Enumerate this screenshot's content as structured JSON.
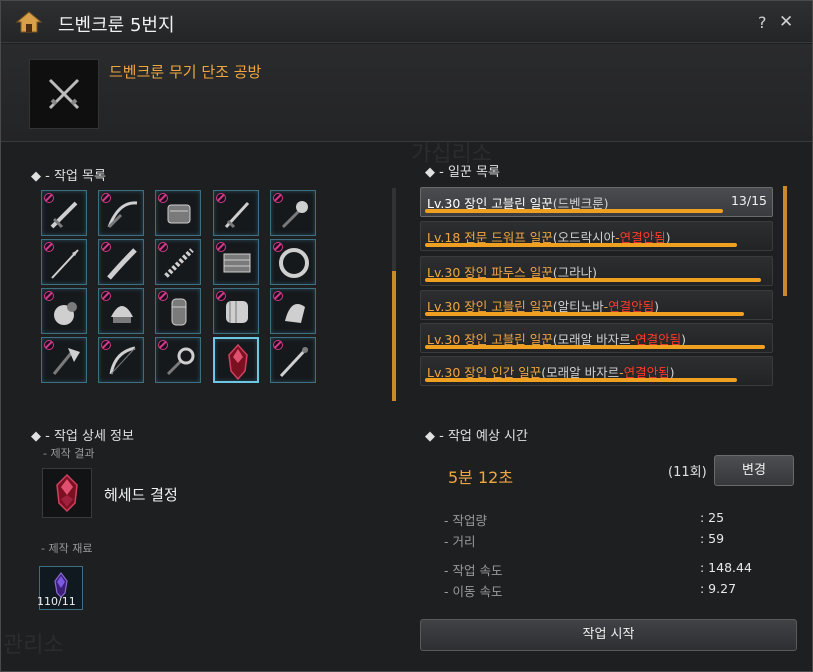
{
  "window": {
    "title": "드벤크룬 5번지",
    "help": "?",
    "close": "✕"
  },
  "building": {
    "name": "드벤크룬 무기 단조 공방"
  },
  "work_list": {
    "title": "◆ - 작업 목록"
  },
  "workers": {
    "title": "◆ - 일꾼 목록",
    "items": [
      {
        "title": "Lv.30 장인 고블린 일꾼",
        "open": "(",
        "loc": "드벤크룬",
        "dash": "",
        "disconnect": "",
        "close": ")",
        "count": "13/15",
        "stamina": 0.87,
        "selected": true
      },
      {
        "title": "Lv.18 전문 드워프 일꾼",
        "open": "(",
        "loc": "오드락시아",
        "dash": "-",
        "disconnect": "연결안됨",
        "close": ")",
        "count": "",
        "stamina": 0.91,
        "selected": false
      },
      {
        "title": "Lv.30 장인 파두스 일꾼",
        "open": "(",
        "loc": "그라나",
        "dash": "",
        "disconnect": "",
        "close": ")",
        "count": "",
        "stamina": 0.98,
        "selected": false
      },
      {
        "title": "Lv.30 장인 고블린 일꾼",
        "open": "(",
        "loc": "알티노바",
        "dash": "-",
        "disconnect": "연결안됨",
        "close": ")",
        "count": "",
        "stamina": 0.93,
        "selected": false
      },
      {
        "title": "Lv.30 장인 고블린 일꾼",
        "open": "(",
        "loc": "모래알 바자르",
        "dash": "-",
        "disconnect": "연결안됨",
        "close": ")",
        "count": "",
        "stamina": 0.99,
        "selected": false
      },
      {
        "title": "Lv.30 장인 인간 일꾼",
        "open": "(",
        "loc": "모래알 바자르",
        "dash": "-",
        "disconnect": "연결안됨",
        "close": ")",
        "count": "",
        "stamina": 0.91,
        "selected": false
      }
    ]
  },
  "detail": {
    "title": "◆ - 작업 상세 정보",
    "result_label": "- 제작 결과",
    "result_name": "헤세드 결정",
    "material_label": "- 제작 재료",
    "material_count": "110/11"
  },
  "estimate": {
    "title": "◆ - 작업 예상 시간",
    "time": "5분 12초",
    "times": "(11회)",
    "change_label": "변경",
    "stats": [
      {
        "label": "- 작업량",
        "value": ": 25"
      },
      {
        "label": "- 거리",
        "value": ": 59"
      },
      {
        "label": "- 작업 속도",
        "value": ": 148.44"
      },
      {
        "label": "- 이동 속도",
        "value": ": 9.27"
      }
    ]
  },
  "start_label": "작업 시작",
  "background_text": {
    "top": "가십리소",
    "bottom": "관리소"
  },
  "colors": {
    "accent": "#f0a640",
    "disconnected": "#ff3b2b",
    "stamina_bar": "#f0a020",
    "cell_border": "#3d6f80"
  }
}
